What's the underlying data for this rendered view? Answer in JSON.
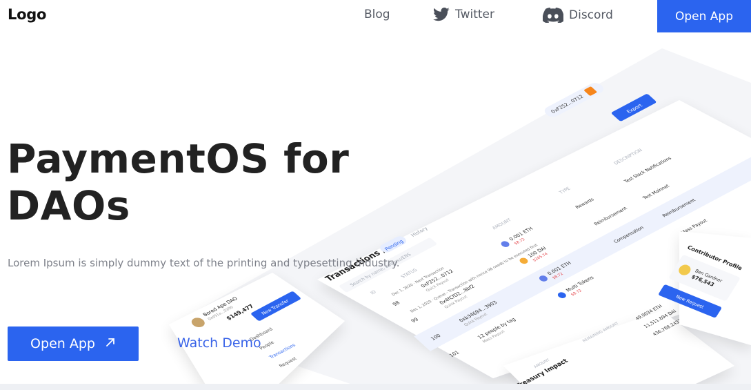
{
  "nav": {
    "logo": "Logo",
    "blog": "Blog",
    "twitter": "Twitter",
    "discord": "Discord",
    "open_app": "Open App"
  },
  "hero": {
    "title_line1": "PaymentOS for",
    "title_line2": "DAOs",
    "subtitle": "Lorem Ipsum is simply dummy text of the printing and typesetting industry.",
    "cta_label": "Open App",
    "cta_icon": "arrow-up-right-icon",
    "watch_demo": "Watch Demo"
  },
  "mockup": {
    "wallet": "0xF252...0712",
    "export_label": "Export",
    "breadcrumb": "Transactions /",
    "tab_pending": "Pending",
    "tab_history": "History",
    "search_placeholder": "Search by name, address/ENS",
    "columns": [
      "ID",
      "STATUS",
      "AMOUNT",
      "TYPE",
      "DESCRIPTION"
    ],
    "rows": [
      {
        "id": "98",
        "date": "Dec 1, 2020 · Next Transaction",
        "to": "0xF252...0712",
        "sub": "Quick Payout",
        "amount": "0.001 ETH",
        "usd": "$8.72",
        "type": "Rewards",
        "desc": "Test Slack Notifications"
      },
      {
        "id": "99",
        "date": "Dec 1, 2020 · Queue - Transaction with nonce 98 needs to be executed first",
        "to": "0x4fCfD2...8bf2",
        "sub": "Quick Payout",
        "amount": "100 DAI",
        "usd": "$245.74",
        "type": "Reimbursement",
        "desc": "Test Mainnet"
      },
      {
        "id": "100",
        "date": "",
        "to": "0xb34694...3903",
        "sub": "Quick Payout",
        "amount": "0.001 ETH",
        "usd": "$8.72",
        "type": "Compensation",
        "desc": "Reimbursement"
      },
      {
        "id": "101",
        "date": "",
        "to": "12 people by tag",
        "sub": "Mass Payout",
        "amount": "Multi Tokens",
        "usd": "$8.72",
        "type": "",
        "desc": "Mass Payout"
      }
    ],
    "sidebar": {
      "org_name": "Bored Ape DAO",
      "org_addr": "0xd91a...0300",
      "balance": "$149,477",
      "new_transfer": "New Transfer",
      "items": [
        "Dashboard",
        "People",
        "Transactions",
        "Request"
      ]
    },
    "treasury": {
      "title": "Treasury Impact",
      "col_amount": "AMOUNT",
      "col_remaining": "REMAINING AMOUNT",
      "values": [
        "49.0034 ETH",
        "11,511.894 DAI",
        "436,788.2437 USDC"
      ]
    },
    "contributor": {
      "title": "Contributor Profile",
      "name": "Ben Gardner",
      "amount": "$76,543",
      "request": "New Request"
    }
  },
  "colors": {
    "brand": "#2b64ef",
    "text_dark": "#222222",
    "text_muted": "#7d8089",
    "danger": "#e5484d"
  }
}
